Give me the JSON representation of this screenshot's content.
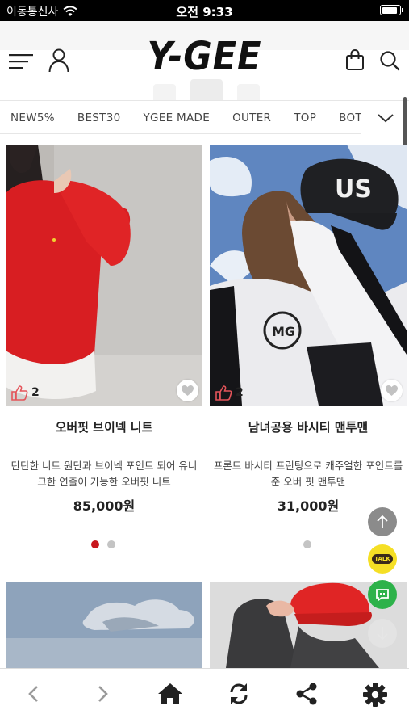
{
  "status_bar": {
    "carrier": "이동통신사",
    "time": "오전 9:33",
    "battery_level": 0.9
  },
  "header": {
    "logo": "Y-GEE",
    "icons": [
      "menu-icon",
      "user-icon",
      "shopping-bag-icon",
      "search-icon"
    ]
  },
  "categories": {
    "items": [
      "NEW5%",
      "BEST30",
      "YGEE MADE",
      "OUTER",
      "TOP",
      "BOTTO"
    ],
    "more_icon": "chevron-down-icon"
  },
  "products": [
    {
      "name": "오버핏 브이넥 니트",
      "description": "탄탄한 니트 원단과 브이넥 포인트 되어 유니크한 연출이 가능한 오버핏 니트",
      "price": "85,000원",
      "likes": "2",
      "image_colors": {
        "main": "#d81e22",
        "background": "#c9c7c4"
      },
      "carousel": {
        "count": 2,
        "active": 0
      }
    },
    {
      "name": "남녀공용 바시티 맨투맨",
      "description": "프론트 바시티 프린팅으로 캐주얼한 포인트를 준 오버 핏 맨투맨",
      "price": "31,000원",
      "likes": "2",
      "image_colors": {
        "main": "#efeff1",
        "background": "#5f86c0"
      },
      "carousel": {
        "count": 1,
        "active": 0
      }
    },
    {
      "image_colors": {
        "main": "#a9b8c9",
        "background": "#7d93ad"
      }
    },
    {
      "image_colors": {
        "main": "#e02525",
        "background": "#d9d9d9"
      }
    }
  ],
  "floating_buttons": {
    "talk_label": "TALK",
    "icons": [
      "arrow-up-icon",
      "kakao-talk-icon",
      "chat-icon",
      "arrow-down-icon"
    ]
  },
  "toolbar": {
    "icons": [
      "back-icon",
      "forward-icon",
      "home-icon",
      "refresh-icon",
      "share-icon",
      "settings-icon"
    ]
  },
  "colors": {
    "accent": "#c8171d",
    "kakao": "#f5df25",
    "chat": "#2db24a"
  }
}
